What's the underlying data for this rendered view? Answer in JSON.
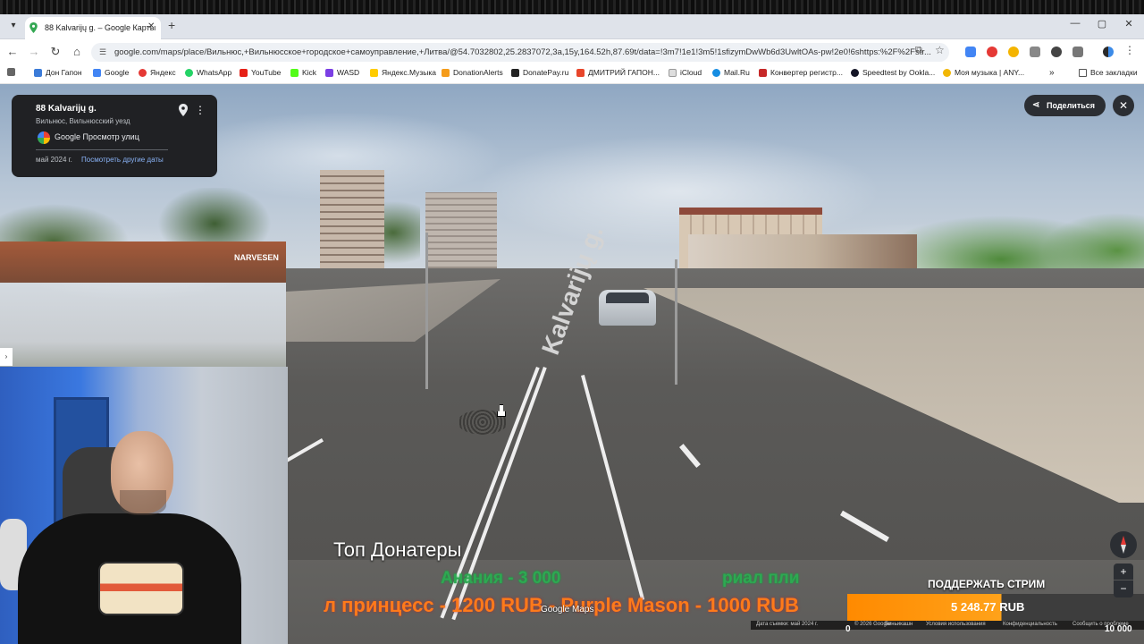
{
  "browser": {
    "tab_title": "88 Kalvarijų g. – Google Карты",
    "url": "google.com/maps/place/Вильнюс,+Вильнюсское+городское+самоуправление,+Литва/@54.7032802,25.2837072,3a,15y,164.52h,87.69t/data=!3m7!1e1!3m5!1sfizymDwWb6d3UwltOAs-pw!2e0!6shttps:%2F%2Fstr..."
  },
  "bookmarks": [
    {
      "label": "Дон Гапон",
      "color": "#3b7bd8"
    },
    {
      "label": "Google",
      "color": "#4285f4"
    },
    {
      "label": "Яндекс",
      "color": "#e53935"
    },
    {
      "label": "WhatsApp",
      "color": "#25d366"
    },
    {
      "label": "YouTube",
      "color": "#e62117"
    },
    {
      "label": "Kick",
      "color": "#53fc18"
    },
    {
      "label": "WASD",
      "color": "#7b3fe4"
    },
    {
      "label": "Яндекс.Музыка",
      "color": "#ffcc00"
    },
    {
      "label": "DonationAlerts",
      "color": "#f59c1a"
    },
    {
      "label": "DonatePay.ru",
      "color": "#222222"
    },
    {
      "label": "ДМИТРИЙ ГАПОН...",
      "color": "#e8462b"
    },
    {
      "label": "iCloud",
      "color": "#dddddd"
    },
    {
      "label": "Mail.Ru",
      "color": "#168de2"
    },
    {
      "label": "Конвертер регистр...",
      "color": "#c62828"
    },
    {
      "label": "Speedtest by Ookla...",
      "color": "#141526"
    },
    {
      "label": "Моя музыка | ANY...",
      "color": "#f2b705"
    }
  ],
  "all_bookmarks_label": "Все закладки",
  "street_view": {
    "title": "88 Kalvarijų g.",
    "subtitle": "Вильнюс, Вильнюсский уезд",
    "service": "Google Просмотр улиц",
    "date": "май 2024 г.",
    "other_dates_link": "Посмотреть другие даты",
    "share_label": "Поделиться",
    "kiosk_sign": "NARVESEN",
    "road_marking": "Kalvarijų g."
  },
  "overlay": {
    "donors_title": "Топ Донатеры",
    "donor_top_left": "Анания - 3 000",
    "donor_top_right": "риал пли",
    "ticker": "л принцесс - 1200 RUB - Purple Mason - 1000 RUB",
    "support_title": "ПОДДЕРЖАТЬ СТРИМ",
    "support_amount": "5 248.77 RUB",
    "support_min": "0",
    "support_goal": "10 000",
    "support_progress": 0.52
  },
  "maps_footer": {
    "watermark": "Google Maps",
    "capture_date": "Дата съемки: май 2024 г.",
    "copyright": "© 2026 Google",
    "links": [
      "Биньикашн",
      "Условия использования",
      "Конфиденциальность",
      "Сообщить о проблеме"
    ]
  },
  "colors": {
    "accent": "#ff8a00",
    "donor_green": "#2ea852",
    "ticker_orange": "#ff7a1a",
    "panel_bg": "#202124"
  }
}
